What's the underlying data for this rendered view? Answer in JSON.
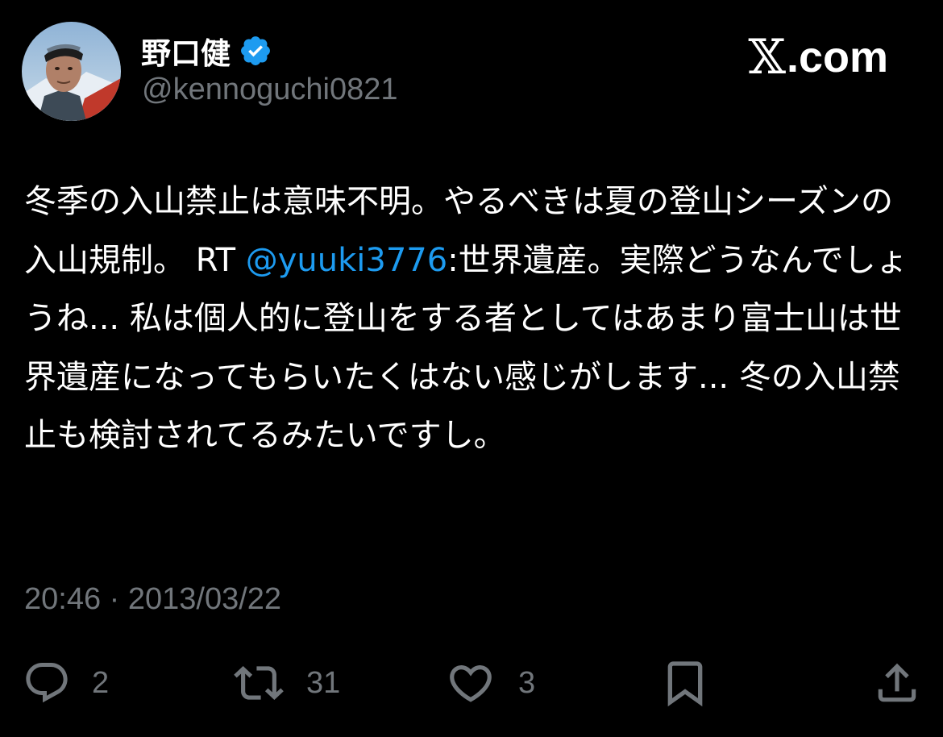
{
  "brand": {
    "x_glyph": "𝕏",
    "domain": ".com"
  },
  "author": {
    "display_name": "野口健",
    "handle": "@kennoguchi0821",
    "verified": true,
    "verified_color": "#1d9bf0"
  },
  "tweet": {
    "text_before": "冬季の入山禁止は意味不明。やるべきは夏の登山シーズンの入山規制。 RT ",
    "mention": "@yuuki3776",
    "text_after": ":世界遺産。実際どうなんでしょうね... 私は個人的に登山をする者としてはあまり富士山は世界遺産になってもらいたくはない感じがします... 冬の入山禁止も検討されてるみたいですし。",
    "timestamp": "20:46 · 2013/03/22"
  },
  "actions": {
    "reply_count": "2",
    "retweet_count": "31",
    "like_count": "3"
  },
  "colors": {
    "background": "#000000",
    "text": "#ffffff",
    "muted": "#71767b",
    "link": "#1d9bf0"
  }
}
